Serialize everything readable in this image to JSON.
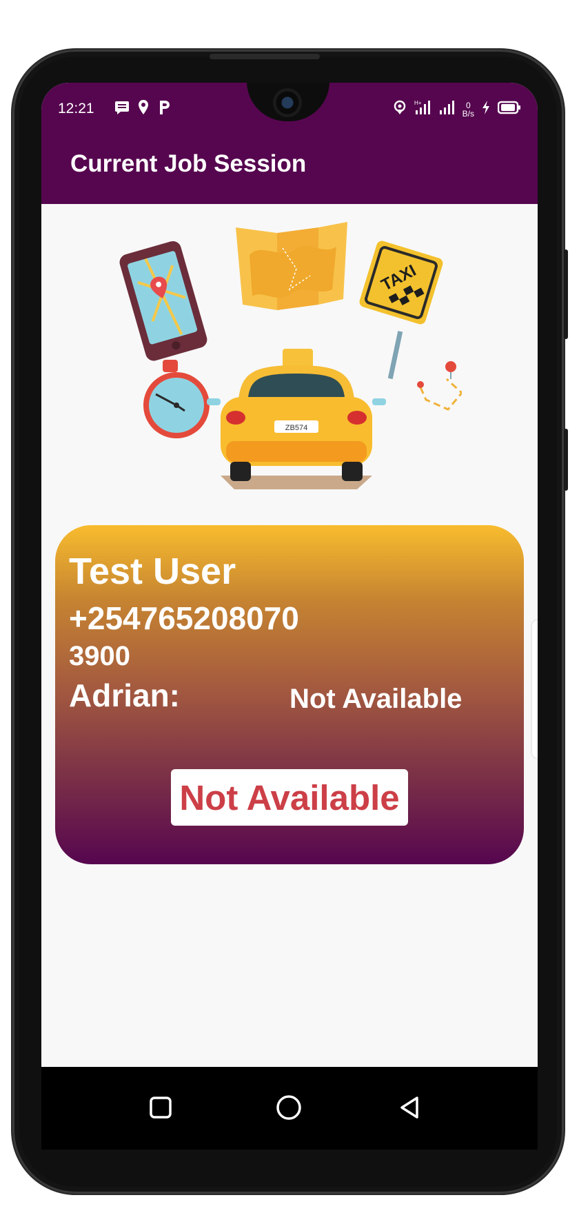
{
  "status_bar": {
    "time": "12:21",
    "left_icons": [
      "message-icon",
      "location-pin-icon",
      "p-icon"
    ],
    "right_icons": [
      "location-icon",
      "signal-icon",
      "signal-icon",
      "data-speed-icon",
      "charging-icon",
      "battery-icon"
    ],
    "data_speed": {
      "value": "0",
      "unit": "B/s"
    }
  },
  "app_bar": {
    "title": "Current Job  Session",
    "color": "#56064f"
  },
  "illustration": {
    "name": "taxi-illustration",
    "taxi_sign_text": "TAXI",
    "plate_text": "ZB574"
  },
  "job_card": {
    "customer_name": "Test User",
    "customer_phone": "+254765208070",
    "fare": "3900",
    "driver_label": "Adrian:",
    "driver_status": "Not Available",
    "action_button_label": "Not Available",
    "gradient": [
      "#f8bc2e",
      "#56064f"
    ],
    "button_text_color": "#cc3f47"
  },
  "nav_bar": {
    "items": [
      "recents-icon",
      "home-icon",
      "back-icon"
    ]
  }
}
